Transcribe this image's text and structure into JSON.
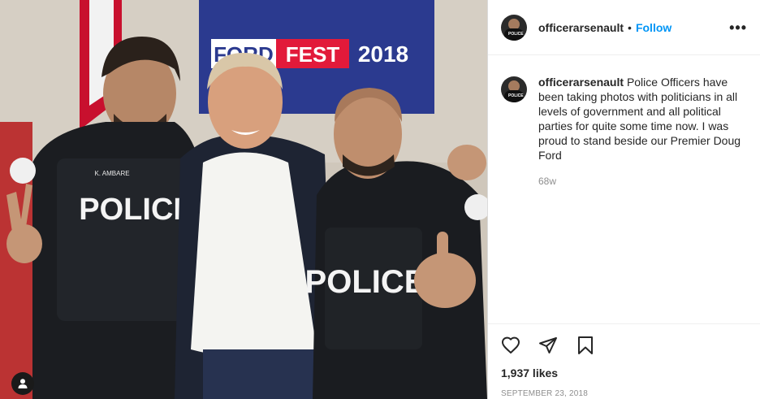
{
  "post": {
    "banner": {
      "left_word": "FORD",
      "right_word": "FEST",
      "year": "2018"
    },
    "badges": {
      "left_police": "POLICE",
      "right_police": "POLICE",
      "name_tag": "K. AMBARE"
    }
  },
  "header": {
    "username": "officerarsenault",
    "separator": "•",
    "follow_label": "Follow",
    "more_label": "•••"
  },
  "caption": {
    "username": "officerarsenault",
    "text": "Police Officers have been taking photos with politicians in all levels of government and all political parties for quite some time now. I was proud to stand beside our Premier Doug Ford",
    "age": "68w"
  },
  "actions": {
    "likes": "1,937 likes",
    "date": "September 23, 2018"
  },
  "colors": {
    "link": "#0095f6",
    "banner_bg": "#2b3a8f",
    "banner_red": "#e21a3a"
  }
}
